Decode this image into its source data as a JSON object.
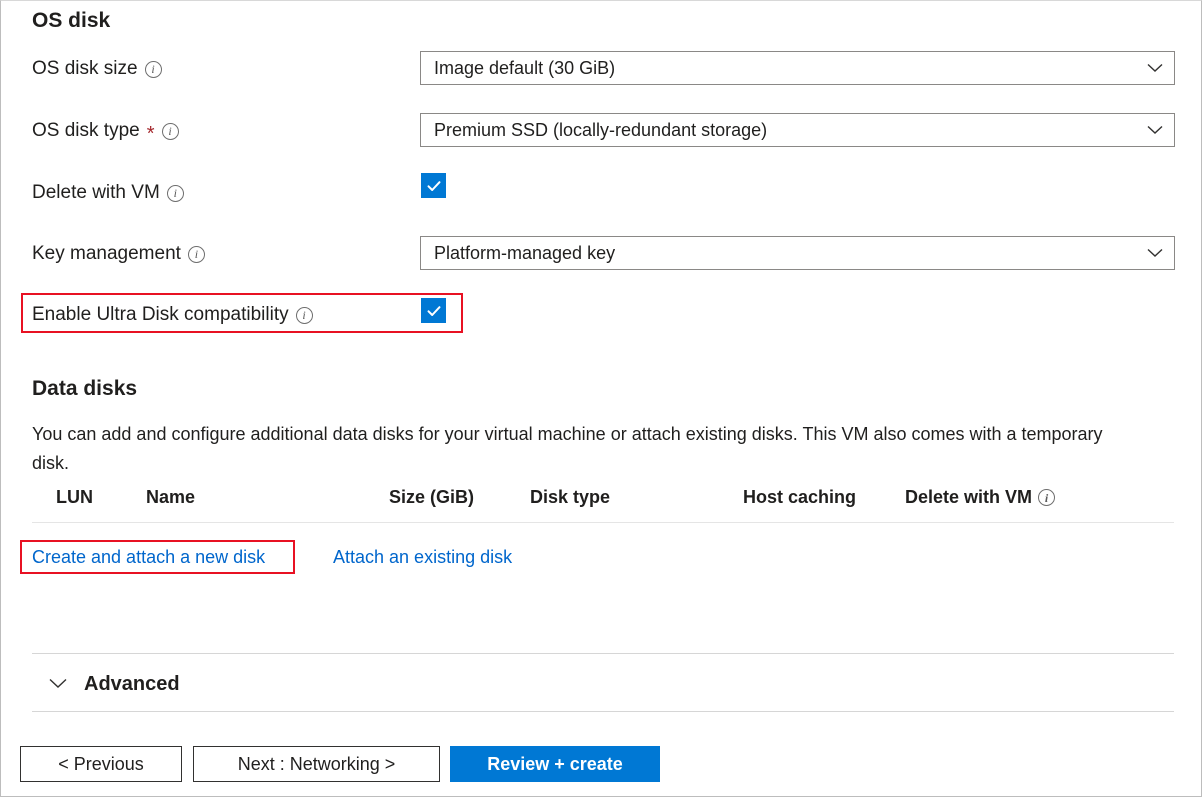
{
  "os_disk": {
    "section_title": "OS disk",
    "fields": [
      {
        "label": "OS disk size",
        "required": false,
        "info_icon": "info-icon",
        "control": "dropdown",
        "value": "Image default (30 GiB)"
      },
      {
        "label": "OS disk type",
        "required": true,
        "required_marker": "*",
        "info_icon": "info-icon",
        "control": "dropdown",
        "value": "Premium SSD (locally-redundant storage)"
      },
      {
        "label": "Delete with VM",
        "required": false,
        "info_icon": "info-icon",
        "control": "checkbox",
        "checked": true
      },
      {
        "label": "Key management",
        "required": false,
        "info_icon": "info-icon",
        "control": "dropdown",
        "value": "Platform-managed key"
      },
      {
        "label": "Enable Ultra Disk compatibility",
        "required": false,
        "info_icon": "info-icon",
        "control": "checkbox",
        "checked": true,
        "highlighted": true
      }
    ]
  },
  "data_disks": {
    "section_title": "Data disks",
    "description": "You can add and configure additional data disks for your virtual machine or attach existing disks. This VM also comes with a temporary disk.",
    "columns": [
      {
        "label": "LUN",
        "info_icon": false
      },
      {
        "label": "Name",
        "info_icon": false
      },
      {
        "label": "Size (GiB)",
        "info_icon": false
      },
      {
        "label": "Disk type",
        "info_icon": false
      },
      {
        "label": "Host caching",
        "info_icon": false
      },
      {
        "label": "Delete with VM",
        "info_icon": true
      }
    ],
    "rows": [],
    "actions": [
      {
        "label": "Create and attach a new disk",
        "highlighted": true
      },
      {
        "label": "Attach an existing disk",
        "highlighted": false
      }
    ]
  },
  "advanced": {
    "label": "Advanced",
    "expand_icon": "chevron-down-icon",
    "expanded": false
  },
  "footer": {
    "previous_label": "< Previous",
    "next_label": "Next : Networking >",
    "review_label": "Review + create"
  },
  "colors": {
    "accent": "#0078d4",
    "link": "#0066cc",
    "highlight": "#e81123",
    "required": "#a4262c",
    "text": "#201f1e",
    "border": "#8a8886"
  }
}
